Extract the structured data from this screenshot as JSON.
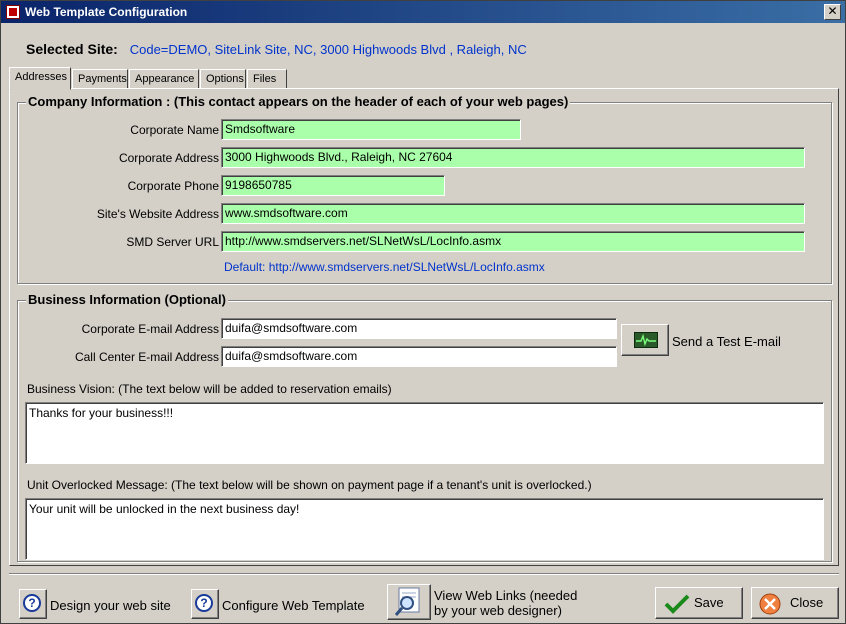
{
  "window": {
    "title": "Web Template Configuration",
    "close_label": "✕"
  },
  "selected_site": {
    "label": "Selected  Site:",
    "value": "Code=DEMO,  SiteLink Site, NC, 3000 Highwoods Blvd , Raleigh, NC"
  },
  "tabs": [
    {
      "label": "Addresses",
      "active": true
    },
    {
      "label": "Payments"
    },
    {
      "label": "Appearance"
    },
    {
      "label": "Options"
    },
    {
      "label": "Files"
    }
  ],
  "company": {
    "title": "Company Information : (This contact appears on the header of each of your web pages)",
    "rows": [
      {
        "label": "Corporate Name",
        "value": "Smdsoftware"
      },
      {
        "label": "Corporate Address",
        "value": "3000 Highwoods Blvd.,  Raleigh, NC 27604"
      },
      {
        "label": "Corporate Phone",
        "value": "9198650785"
      },
      {
        "label": "Site's Website Address",
        "value": "www.smdsoftware.com"
      },
      {
        "label": "SMD Server URL",
        "value": "http://www.smdservers.net/SLNetWsL/LocInfo.asmx"
      }
    ],
    "default_text": "Default: http://www.smdservers.net/SLNetWsL/LocInfo.asmx"
  },
  "business": {
    "title": "Business Information (Optional)",
    "rows": [
      {
        "label": "Corporate E-mail Address",
        "value": "duifa@smdsoftware.com"
      },
      {
        "label": "Call Center E-mail Address",
        "value": "duifa@smdsoftware.com"
      }
    ],
    "test_email_label": "Send a Test E-mail",
    "vision_caption": "Business Vision: (The text below will be added to reservation emails)",
    "vision_text": "Thanks for your business!!!",
    "overlock_caption": "Unit Overlocked Message: (The text below will be shown on payment page if a tenant's unit is overlocked.)",
    "overlock_text": "Your unit will be unlocked in the next business day!"
  },
  "footer": {
    "design_label": "Design your web site",
    "configure_label": "Configure Web Template",
    "view_links_line1": "View Web Links (needed",
    "view_links_line2": "by your web designer)",
    "save_label": "Save",
    "close_label": "Close"
  },
  "colors": {
    "field_green": "#aaffaa",
    "link_blue": "#0033cc",
    "title_bar": "#0a246a"
  }
}
